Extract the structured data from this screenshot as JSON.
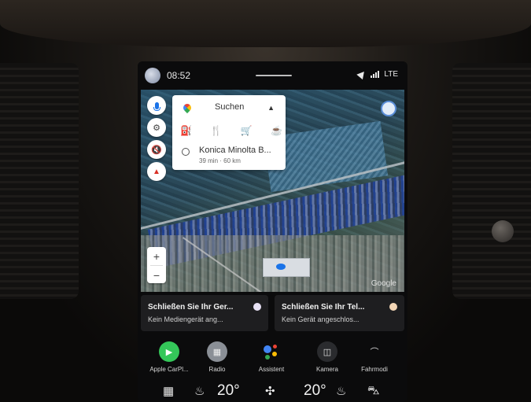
{
  "status": {
    "time": "08:52",
    "network": "LTE"
  },
  "search": {
    "label": "Suchen",
    "recent_title": "Konica Minolta B...",
    "recent_sub": "39 min · 60 km"
  },
  "map": {
    "attribution": "Google",
    "zoom_in": "+",
    "zoom_out": "−"
  },
  "media": [
    {
      "title": "Schließen Sie Ihr Ger...",
      "subtitle": "Kein Mediengerät ang..."
    },
    {
      "title": "Schließen Sie Ihr Tel...",
      "subtitle": "Kein Gerät angeschlos..."
    }
  ],
  "apps": [
    {
      "label": "Apple CarPl..."
    },
    {
      "label": "Radio"
    },
    {
      "label": "Assistent"
    },
    {
      "label": "Kamera"
    },
    {
      "label": "Fahrmodi"
    }
  ],
  "climate": {
    "left_temp": "20°",
    "right_temp": "20°"
  },
  "colors": {
    "carplay_green": "#34c759",
    "google_blue": "#1a73e8"
  }
}
